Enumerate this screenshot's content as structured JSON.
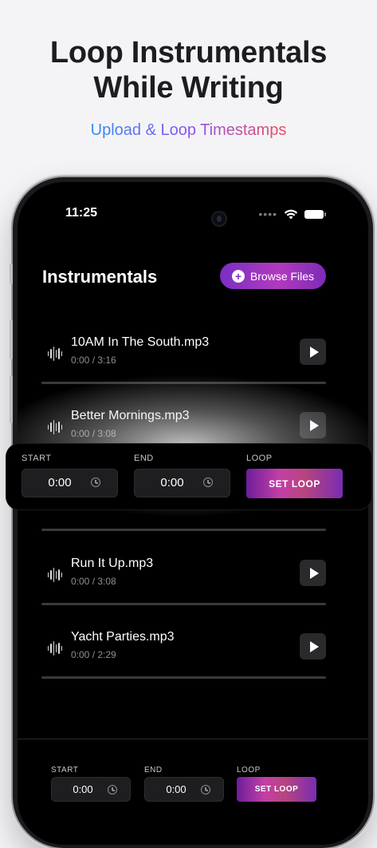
{
  "header": {
    "line1": "Loop Instrumentals",
    "line2": "While Writing",
    "subtitle": "Upload & Loop Timestamps"
  },
  "status_bar": {
    "time": "11:25",
    "cellular_icon": "signal-dots-icon",
    "wifi_icon": "wifi-icon",
    "battery_icon": "battery-icon"
  },
  "app": {
    "title": "Instrumentals",
    "browse_button": {
      "label": "Browse Files",
      "icon": "plus-circle-icon"
    }
  },
  "tracks": [
    {
      "name": "10AM In The South.mp3",
      "time": "0:00 / 3:16"
    },
    {
      "name": "Better Mornings.mp3",
      "time": "0:00 / 3:08"
    },
    {
      "name": "Run It Up.mp3",
      "time": "0:00 / 3:08"
    },
    {
      "name": "Yacht Parties.mp3",
      "time": "0:00 / 2:29"
    }
  ],
  "loop_overlay": {
    "start_label": "START",
    "end_label": "END",
    "loop_label": "LOOP",
    "start_value": "0:00",
    "end_value": "0:00",
    "button_label": "SET LOOP"
  },
  "loop_bar": {
    "start_label": "START",
    "end_label": "END",
    "loop_label": "LOOP",
    "start_value": "0:00",
    "end_value": "0:00",
    "button_label": "SET LOOP"
  },
  "colors": {
    "accent_purple": "#8a2fc0",
    "gradient_blue": "#2f8df5",
    "gradient_red": "#ef4a5e",
    "background": "#f4f4f6",
    "screen": "#000000"
  }
}
